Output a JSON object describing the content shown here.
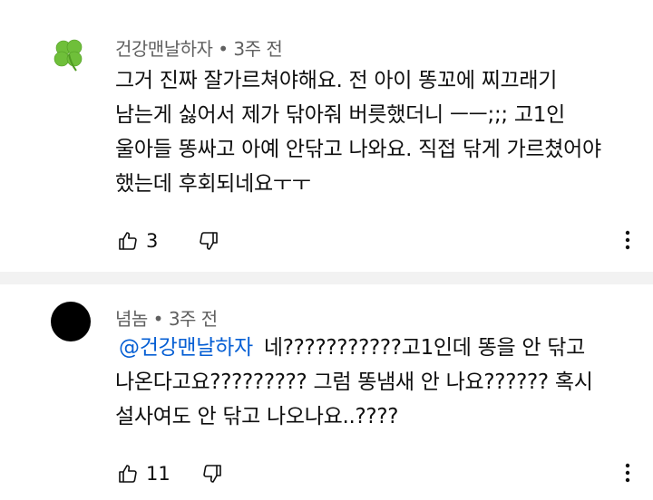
{
  "comments": [
    {
      "author": "건강맨날하자",
      "time": "• 3주 전",
      "avatar_icon": "clover-icon",
      "lines": [
        "그거 진짜 잘가르쳐야해요. 전 아이 똥꼬에 찌끄래기",
        "남는게 싫어서 제가 닦아줘 버릇했더니 ㅡㅡ;;; 고1인",
        "울아들 똥싸고 아예 안닦고 나와요. 직접 닦게 가르쳤어야",
        "했는데 후회되네요ㅜㅜ"
      ],
      "like_count": "3"
    },
    {
      "author": "념놈",
      "time": "• 3주 전",
      "avatar_color": "#000000",
      "mention": "@건강맨날하자",
      "lines": [
        "네???????????고1인데 똥을 안 닦고",
        "나온다고요????????? 그럼 똥냄새 안 나요?????? 혹시",
        "설사여도 안 닦고 나오나요..????"
      ],
      "like_count": "11"
    }
  ],
  "icons": {
    "like": "thumbs-up-icon",
    "dislike": "thumbs-down-icon",
    "more": "more-vert-icon"
  }
}
